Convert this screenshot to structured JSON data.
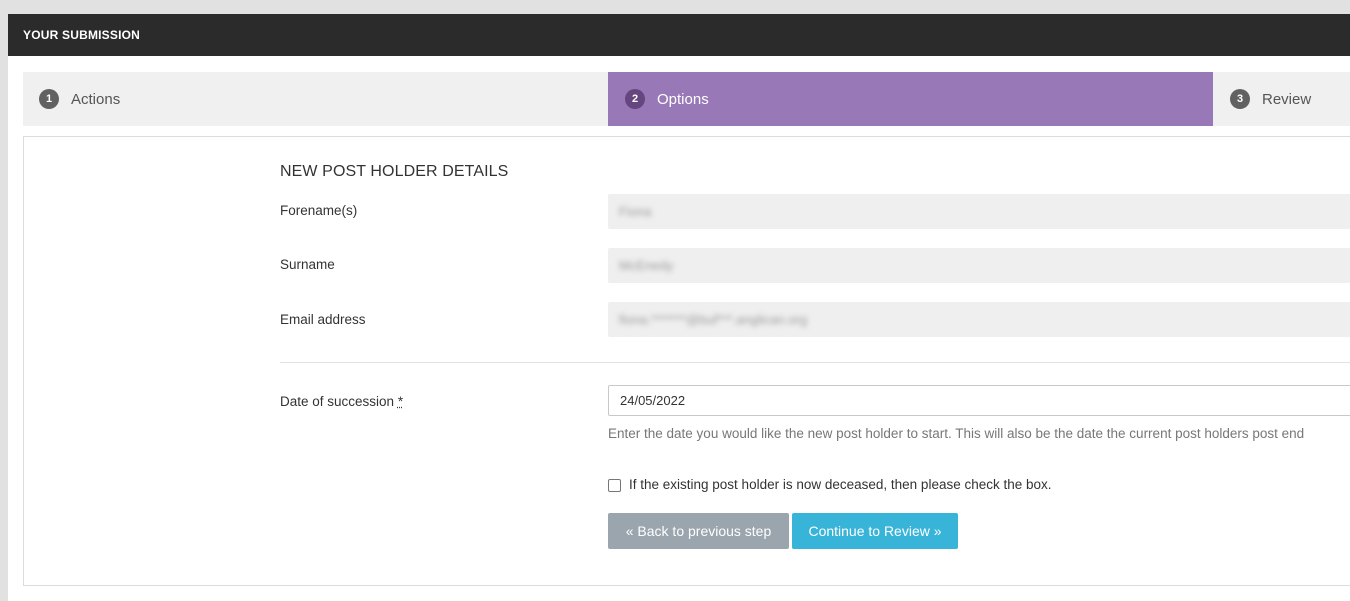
{
  "panel": {
    "title": "YOUR SUBMISSION"
  },
  "steps": [
    {
      "number": "1",
      "label": "Actions",
      "active": false
    },
    {
      "number": "2",
      "label": "Options",
      "active": true
    },
    {
      "number": "3",
      "label": "Review",
      "active": false
    }
  ],
  "form": {
    "section_title": "NEW POST HOLDER DETAILS",
    "forename": {
      "label": "Forename(s)",
      "value": "Fiona"
    },
    "surname": {
      "label": "Surname",
      "value": "McEnedy"
    },
    "email": {
      "label": "Email address",
      "value": "fiona.*******@buf***.anglican.org"
    },
    "date_of_succession": {
      "label": "Date of succession",
      "required_marker": "*",
      "value": "24/05/2022",
      "help": "Enter the date you would like the new post holder to start. This will also be the date the current post holders post end"
    },
    "deceased_checkbox": {
      "label": "If the existing post holder is now deceased, then please check the box.",
      "checked": false
    },
    "back_button": "« Back to previous step",
    "continue_button": "Continue to Review »"
  },
  "colors": {
    "header_bg": "#2b2b2b",
    "active_step": "#9878b6",
    "back_button": "#9aa5ad",
    "continue_button": "#38b4d9"
  }
}
